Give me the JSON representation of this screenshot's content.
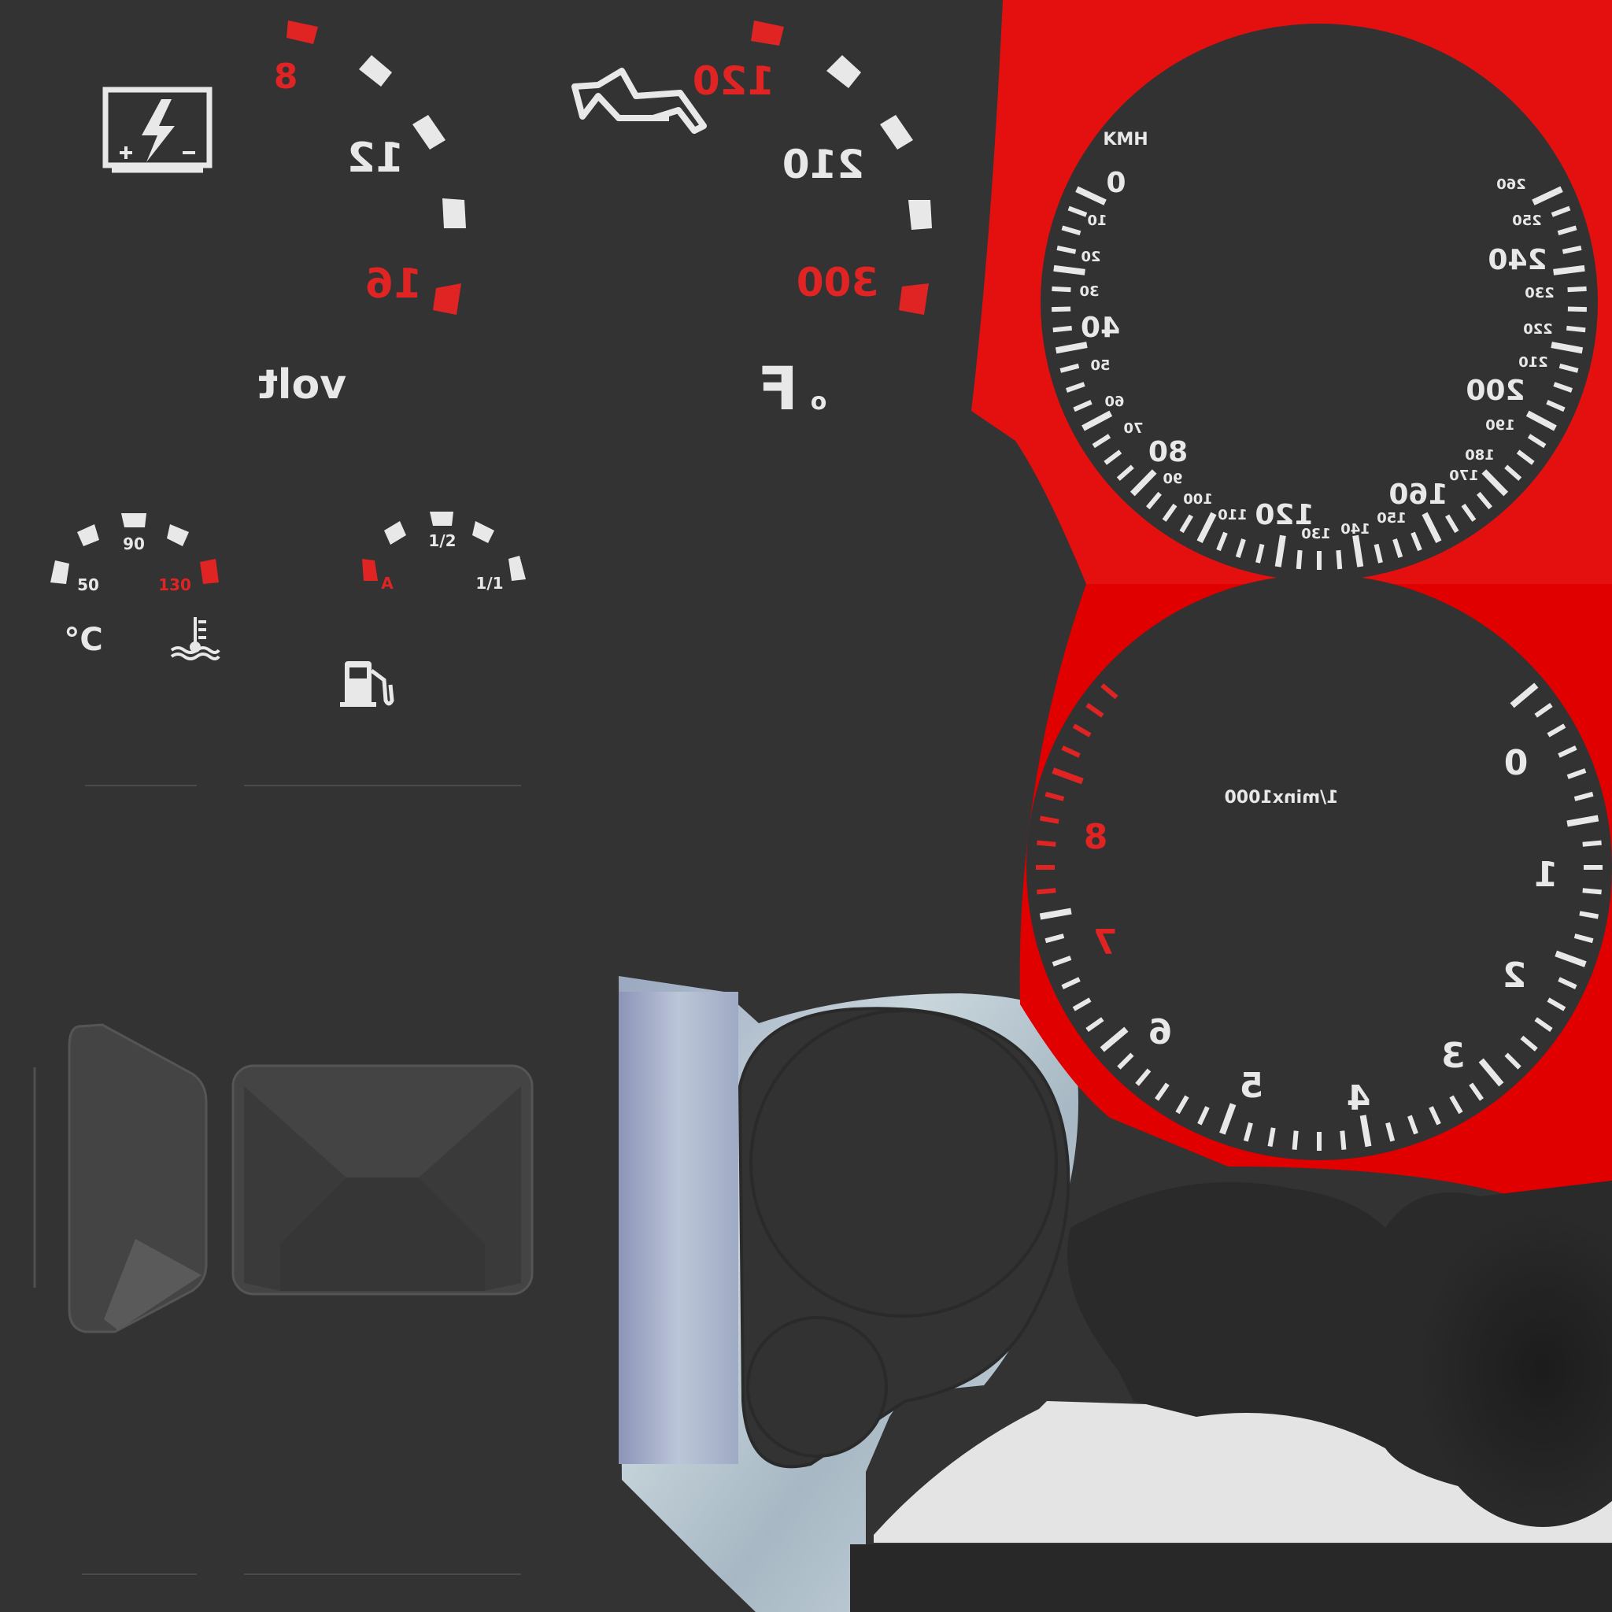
{
  "colors": {
    "background": "#333333",
    "gauge_face": "#323232",
    "bezel_red": "#e41010",
    "marking_white": "#e8e8e8",
    "marking_red": "#e02424",
    "chrome": "#b8c6d0",
    "gauge_shadow": "#222222",
    "floor_white": "#e4e4e4"
  },
  "volt_gauge": {
    "icon": "battery-icon",
    "labels": [
      "8",
      "12",
      "16"
    ],
    "unit": "volt"
  },
  "oil_gauge": {
    "icon": "oil-can-icon",
    "labels": [
      "120",
      "210",
      "300"
    ],
    "unit_degree": "o",
    "unit_letter": "F"
  },
  "temp_gauge": {
    "labels": [
      "50",
      "90",
      "130"
    ],
    "unit": "°C",
    "icon": "coolant-temperature-icon"
  },
  "fuel_gauge": {
    "labels": [
      "A",
      "1/2",
      "1/1"
    ],
    "icon": "fuel-pump-icon"
  },
  "speedometer": {
    "unit": "KMH",
    "major_labels": [
      "0",
      "40",
      "80",
      "120",
      "160",
      "200",
      "240"
    ],
    "minor_labels": [
      "10",
      "20",
      "30",
      "50",
      "60",
      "70",
      "90",
      "100",
      "110",
      "130",
      "140",
      "150",
      "170",
      "180",
      "190",
      "210",
      "220",
      "230",
      "250",
      "260"
    ]
  },
  "tachometer": {
    "unit": "1/minx1000",
    "labels": [
      "0",
      "1",
      "2",
      "3",
      "4",
      "5",
      "6",
      "7",
      "8"
    ],
    "redline_from": 7
  }
}
